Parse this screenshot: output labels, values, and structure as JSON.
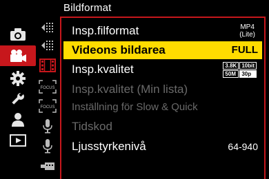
{
  "header": {
    "title": "Bildformat"
  },
  "categories": [
    {
      "name": "photo",
      "icon": "camera-icon",
      "active": false
    },
    {
      "name": "video",
      "icon": "video-camera-icon",
      "active": true
    },
    {
      "name": "custom",
      "icon": "gear-icon",
      "active": false
    },
    {
      "name": "setup",
      "icon": "wrench-icon",
      "active": false
    },
    {
      "name": "mymenu",
      "icon": "person-icon",
      "active": false
    },
    {
      "name": "playback",
      "icon": "playback-icon",
      "active": false
    }
  ],
  "subcategories": [
    {
      "icon": "image-format-icon"
    },
    {
      "icon": "image-format-icon"
    },
    {
      "icon": "film-icon"
    },
    {
      "icon": "focus-icon"
    },
    {
      "icon": "focus-icon"
    },
    {
      "icon": "microphone-icon"
    },
    {
      "icon": "microphone-icon"
    },
    {
      "icon": "hdmi-icon"
    }
  ],
  "subcategory_labels": {
    "focus": "FOCUS"
  },
  "menu": {
    "items": [
      {
        "label": "Insp.filformat",
        "value_line1": "MP4",
        "value_line2": "(Lite)"
      },
      {
        "label": "Videons bildarea",
        "value": "FULL"
      },
      {
        "label": "Insp.kvalitet",
        "badge": [
          "3.8K",
          "10bit",
          "50M",
          "30p"
        ]
      },
      {
        "label": "Insp.kvalitet (Min lista)"
      },
      {
        "label": "Inställning för Slow & Quick"
      },
      {
        "label": "Tidskod"
      },
      {
        "label": "Ljusstyrkenivå",
        "value": "64-940"
      }
    ]
  },
  "colors": {
    "accent_red": "#c7171c",
    "highlight_yellow": "#ffdc00",
    "disabled": "#6a6a6a"
  }
}
